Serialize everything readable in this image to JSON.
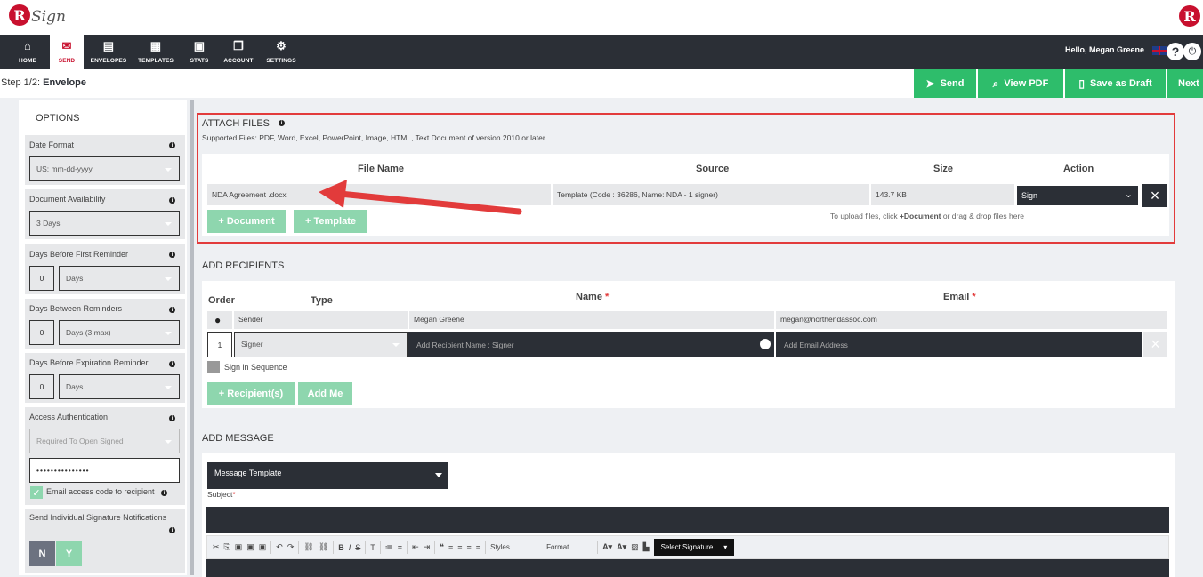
{
  "header": {
    "logo_text": "Sign",
    "logo_letter": "R"
  },
  "nav": {
    "items": [
      {
        "label": "HOME",
        "icon": "home-icon",
        "glyph": "⌂"
      },
      {
        "label": "SEND",
        "icon": "envelope-icon",
        "glyph": "✉"
      },
      {
        "label": "ENVELOPES",
        "icon": "inbox-icon",
        "glyph": "▤"
      },
      {
        "label": "TEMPLATES",
        "icon": "document-icon",
        "glyph": "▦"
      },
      {
        "label": "STATS",
        "icon": "briefcase-icon",
        "glyph": "▣"
      },
      {
        "label": "ACCOUNT",
        "icon": "copy-icon",
        "glyph": "❐"
      },
      {
        "label": "SETTINGS",
        "icon": "gear-icon",
        "glyph": "⚙"
      }
    ],
    "greeting": "Hello, Megan Greene",
    "help": "?",
    "power": "⏻"
  },
  "step": {
    "prefix": "Step 1/2:",
    "name": "Envelope"
  },
  "actions": {
    "send": "Send",
    "view_pdf": "View PDF",
    "save_draft": "Save as Draft",
    "next": "Next"
  },
  "options": {
    "title": "OPTIONS",
    "date_format": {
      "label": "Date Format",
      "value": "US: mm-dd-yyyy"
    },
    "doc_availability": {
      "label": "Document Availability",
      "value": "3 Days"
    },
    "first_reminder": {
      "label": "Days Before First Reminder",
      "num": "0",
      "unit": "Days"
    },
    "between_reminders": {
      "label": "Days Between Reminders",
      "num": "0",
      "unit": "Days (3 max)"
    },
    "expiration_reminder": {
      "label": "Days Before Expiration Reminder",
      "num": "0",
      "unit": "Days"
    },
    "access_auth": {
      "label": "Access Authentication",
      "value": "Required To Open Signed",
      "password": "•••••••••••••••"
    },
    "email_code": "Email access code to recipient",
    "individual_notif": {
      "label": "Send Individual Signature Notifications",
      "n": "N",
      "y": "Y"
    }
  },
  "attach": {
    "title": "ATTACH FILES",
    "supported": "Supported Files: PDF, Word, Excel, PowerPoint, Image, HTML, Text Document of version 2010 or later",
    "columns": {
      "file_name": "File Name",
      "source": "Source",
      "size": "Size",
      "action": "Action"
    },
    "row": {
      "file_name": "NDA Agreement .docx",
      "source": "Template (Code : 36286, Name: NDA - 1 signer)",
      "size": "143.7 KB",
      "action": "Sign"
    },
    "add_document": "+ Document",
    "add_template": "+ Template",
    "hint_pre": "To upload files, click ",
    "hint_bold": "+Document",
    "hint_post": " or drag & drop files here"
  },
  "recipients": {
    "title": "ADD RECIPIENTS",
    "columns": {
      "order": "Order",
      "type": "Type",
      "name": "Name",
      "email": "Email"
    },
    "sender": {
      "type": "Sender",
      "name": "Megan Greene",
      "email": "megan@northendassoc.com"
    },
    "signer": {
      "order": "1",
      "type": "Signer",
      "name_placeholder": "Add Recipient Name : Signer",
      "email_placeholder": "Add Email Address"
    },
    "sign_in_sequence": "Sign in Sequence",
    "add_recipients": "+ Recipient(s)",
    "add_me": "Add Me"
  },
  "message": {
    "title": "ADD MESSAGE",
    "template_select": "Message Template",
    "subject_label": "Subject",
    "toolbar": {
      "styles": "Styles",
      "format": "Format",
      "signature": "Select Signature"
    }
  },
  "colors": {
    "accent_green": "#2ebd6b",
    "light_green": "#8ed6ae",
    "dark": "#2b2f36",
    "brand_red": "#c8102e",
    "highlight_red": "#e23b3b"
  }
}
